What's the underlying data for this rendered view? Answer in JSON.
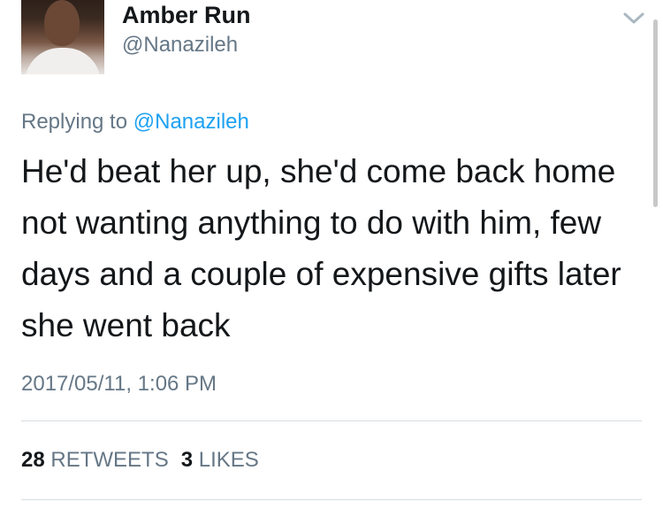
{
  "author": {
    "name": "Amber Run",
    "handle": "@Nanazileh"
  },
  "reply": {
    "prefix": "Replying to ",
    "mention": "@Nanazileh"
  },
  "tweet": {
    "text": "He'd beat her up, she'd come back home not wanting anything to do with him, few days and a couple of expensive gifts later she went back",
    "timestamp": "2017/05/11, 1:06 PM"
  },
  "stats": {
    "retweets_count": "28",
    "retweets_label": "RETWEETS",
    "likes_count": "3",
    "likes_label": "LIKES"
  },
  "colors": {
    "secondary_text": "#657786",
    "link": "#1da1f2",
    "primary_text": "#14171a",
    "divider": "#d7dde2"
  },
  "icons": {
    "menu": "chevron-down-icon"
  }
}
